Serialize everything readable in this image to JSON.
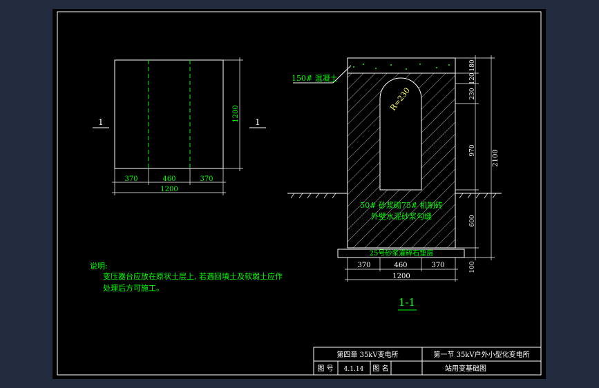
{
  "plan": {
    "section_mark_left": "1",
    "section_mark_right": "1",
    "dims": {
      "left": "370",
      "middle": "460",
      "right": "370",
      "total": "1200",
      "height": "1200"
    }
  },
  "section": {
    "label_concrete": "150# 混凝土",
    "label_radius": "R=230",
    "label_masonry_1": "50# 砂浆砌75# 机制砖",
    "label_masonry_2": "外壁水泥砂浆勾缝",
    "label_base": "25号砂浆灌碎石垫层",
    "dims": {
      "left": "370",
      "middle": "460",
      "right": "370",
      "total": "1200",
      "v_180": "180",
      "v_120": "120",
      "v_230": "230",
      "v_970": "970",
      "v_600": "600",
      "v_100": "100",
      "v_total": "2100"
    },
    "caption": "1-1"
  },
  "notes": {
    "title": "说明:",
    "line1": "变压器台应放在原状土层上, 若遇回填土及软弱土应作",
    "line2": "处理后方可施工。"
  },
  "title_block": {
    "chapter": "第四章 35kV变电所",
    "section": "第一节 35kV户外小型化变电所",
    "drawing_no_label": "图 号",
    "drawing_no": "4.1.14",
    "drawing_name_label": "图 名",
    "drawing_name": "站用变基础图"
  },
  "colors": {
    "background": "#000000",
    "lines": "#ffffff",
    "text": "#00ff00",
    "frame": "#212b3d"
  }
}
